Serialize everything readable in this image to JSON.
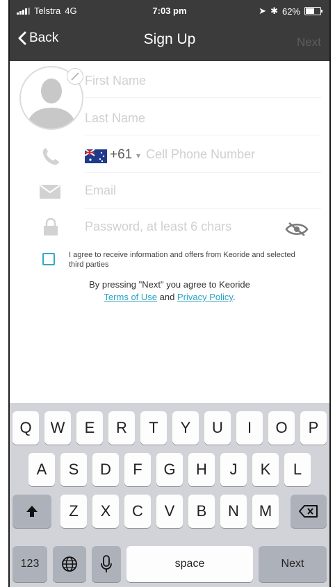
{
  "status_bar": {
    "carrier": "Telstra",
    "network": "4G",
    "time": "7:03 pm",
    "battery": "62%",
    "battery_level": 0.62
  },
  "nav": {
    "back_label": "Back",
    "title": "Sign Up",
    "next_label": "Next"
  },
  "form": {
    "first_name_placeholder": "First Name",
    "last_name_placeholder": "Last Name",
    "country_code": "+61",
    "phone_placeholder": "Cell Phone Number",
    "email_placeholder": "Email",
    "password_placeholder": "Password, at least 6 chars"
  },
  "consent": {
    "checkbox_text": "I agree to receive information and offers from Keoride and selected third parties",
    "terms_prefix": "By pressing \"Next\" you agree to Keoride",
    "terms_link": "Terms of Use",
    "and_text": "and",
    "privacy_link": "Privacy Policy",
    "period": "."
  },
  "keyboard": {
    "row1": [
      "Q",
      "W",
      "E",
      "R",
      "T",
      "Y",
      "U",
      "I",
      "O",
      "P"
    ],
    "row2": [
      "A",
      "S",
      "D",
      "F",
      "G",
      "H",
      "J",
      "K",
      "L"
    ],
    "row3": [
      "Z",
      "X",
      "C",
      "V",
      "B",
      "N",
      "M"
    ],
    "numbers_key": "123",
    "space_key": "space",
    "next_key": "Next"
  },
  "colors": {
    "nav_bg": "#3b3b3b",
    "accent": "#2fa9c8",
    "placeholder": "#d0d0d0",
    "keyboard_bg": "#d1d3d8"
  }
}
